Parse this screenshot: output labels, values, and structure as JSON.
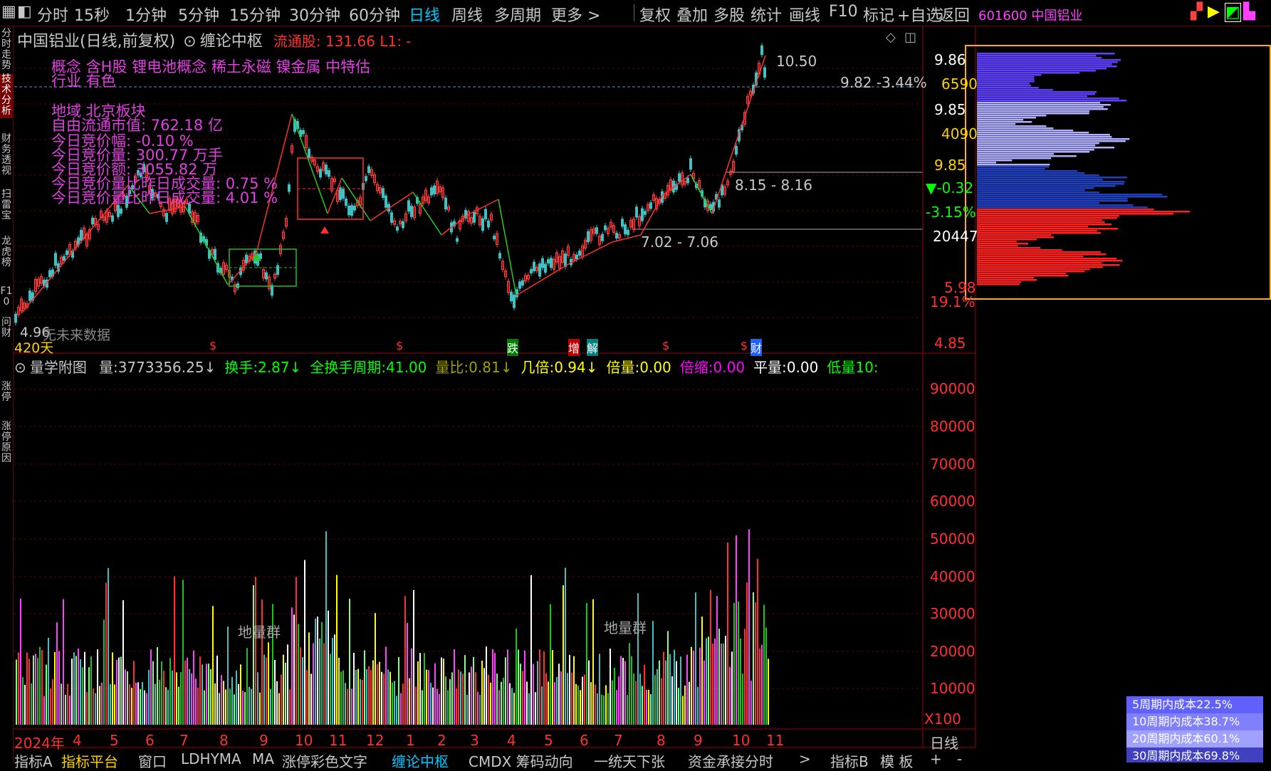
{
  "toolbar": {
    "periods": [
      "分时",
      "15秒",
      "1分钟",
      "5分钟",
      "15分钟",
      "30分钟",
      "60分钟",
      "日线",
      "周线",
      "多周期",
      "更多 >"
    ],
    "actions": [
      "复权",
      "叠加",
      "多股",
      "统计",
      "画线",
      "F10",
      "标记",
      "+自选",
      "返回"
    ],
    "stock_code_name": "601600 中国铝业"
  },
  "sidebar": [
    "分时走势",
    "技术分析",
    "财务透视",
    "扫雷宝",
    "龙虎榜",
    "F10",
    "问财",
    "涨停",
    "涨停原因"
  ],
  "main_panel": {
    "title": "中国铝业(日线,前复权)",
    "indicator": "缠论中枢",
    "float_shares": "流通股: 131.66 L1: -",
    "info_lines": [
      "概念 含H股 锂电池概念 稀土永磁 镍金属 中特估",
      "行业 有色",
      "地域 北京板块",
      "自由流通市值: 762.18 亿",
      "今日竞价幅: -0.10 %",
      "今日竞价量: 300.77 万手",
      "今日竞价额: 3055.82 万",
      "今日竞价量比昨日成交量: 0.75 %",
      "今日竞价量比昨日成交量: 4.01 %"
    ],
    "price_high": "10.50",
    "price_current": "9.82 -3.44%",
    "range_1": "8.15 - 8.16",
    "range_2": "7.02 - 7.06",
    "price_low": "4.96",
    "no_future_data": "无未来数据",
    "days": "420天",
    "markers": [
      "$",
      "$",
      "跌",
      "增",
      "解",
      "$",
      "$",
      "财"
    ],
    "axis": [
      "9.86",
      "6590",
      "9.85",
      "4090",
      "9.85",
      "▼-0.32",
      "-3.15%",
      "20447",
      "5.98",
      "19.1%",
      "4.85"
    ]
  },
  "volume_panel": {
    "title": "量学附图",
    "metrics": [
      {
        "label": "量:",
        "value": "3773356.25↓",
        "color": "#c8c8c8"
      },
      {
        "label": "换手:",
        "value": "2.87↓",
        "color": "#00ff00"
      },
      {
        "label": "全换手周期:",
        "value": "41.00",
        "color": "#00ff00"
      },
      {
        "label": "量比:",
        "value": "0.81↓",
        "color": "#a0a000"
      },
      {
        "label": "几倍:",
        "value": "0.94↓",
        "color": "#ffff00"
      },
      {
        "label": "倍量:",
        "value": "0.00",
        "color": "#ffff00"
      },
      {
        "label": "倍缩:",
        "value": "0.00",
        "color": "#ff00ff"
      },
      {
        "label": "平量:",
        "value": "0.00",
        "color": "#ffffff"
      },
      {
        "label": "低量10:",
        "value": "",
        "color": "#00ff00"
      }
    ],
    "axis": [
      "90000",
      "80000",
      "70000",
      "60000",
      "50000",
      "40000",
      "30000",
      "20000",
      "10000",
      "X100"
    ],
    "labels": [
      "地量群",
      "地量群"
    ]
  },
  "date_axis": {
    "labels": [
      "2024年",
      "4",
      "5",
      "6",
      "7",
      "8",
      "9",
      "10",
      "11",
      "12",
      "1",
      "2",
      "3",
      "4",
      "5",
      "6",
      "7",
      "8",
      "9",
      "10",
      "11"
    ],
    "period": "日线"
  },
  "bottom_tabs": [
    "指标A",
    "指标平台",
    "窗口",
    "LDHYMA",
    "MA",
    "涨停彩色文字",
    "缠论中枢",
    "CMDX 筹码动向",
    "一统天下张",
    "资金承接分时",
    "指标B",
    "模 板",
    "+",
    "-"
  ],
  "cost_legend": [
    {
      "text": "5周期内成本22.5%",
      "color": "#6060ff"
    },
    {
      "text": "10周期内成本38.7%",
      "color": "#8080ff"
    },
    {
      "text": "20周期内成本60.1%",
      "color": "#a0a0ff"
    },
    {
      "text": "30周期内成本69.8%",
      "color": "#4040c0"
    }
  ]
}
